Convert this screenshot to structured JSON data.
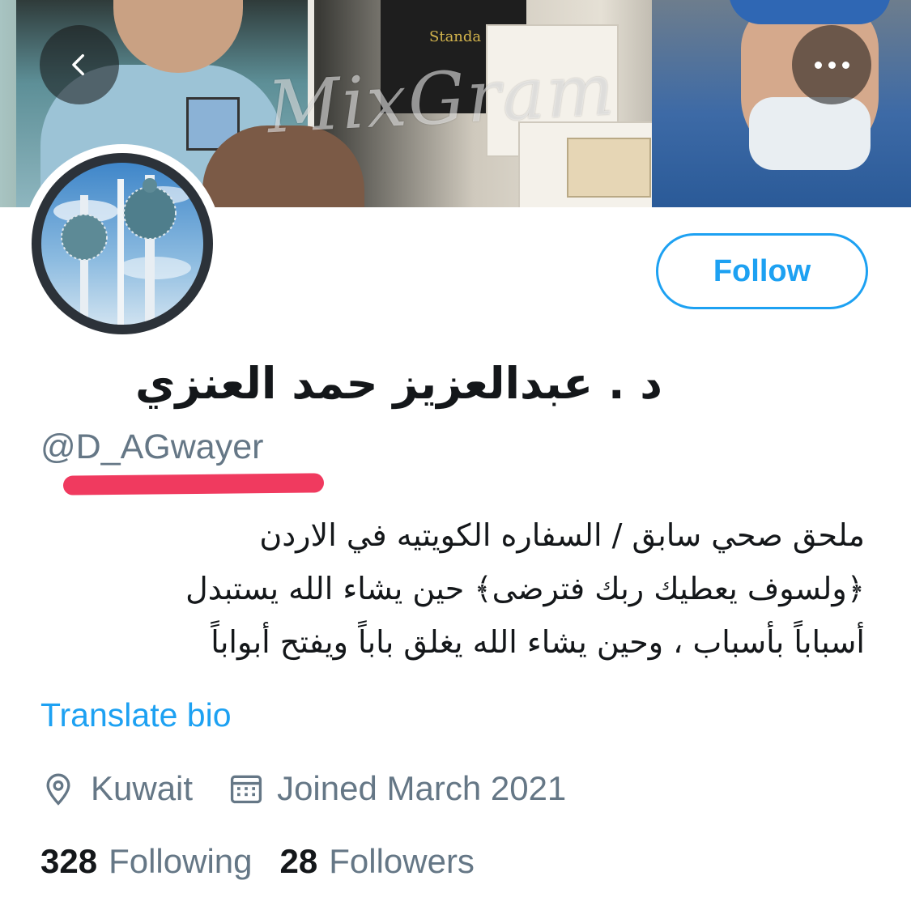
{
  "header": {
    "banner_watermark": "MixGram",
    "back_icon": "chevron-left-icon",
    "more_icon": "more-horizontal-icon"
  },
  "profile": {
    "display_name": "د . عبدالعزيز حمد العنزي",
    "handle": "@D_AGwayer",
    "bio_lines": [
      "ملحق صحي سابق / السفاره الكويتيه في الاردن",
      "﴿ولسوف يعطيك ربك فترضى﴾ حين يشاء الله يستبدل",
      "أسباباً بأسباب ، وحين يشاء الله يغلق باباً ويفتح أبواباً"
    ],
    "translate_label": "Translate bio",
    "location": "Kuwait",
    "location_icon": "location-pin-icon",
    "joined": "Joined March 2021",
    "joined_icon": "calendar-icon",
    "following_count": "328",
    "following_label": "Following",
    "followers_count": "28",
    "followers_label": "Followers"
  },
  "actions": {
    "follow_label": "Follow"
  },
  "colors": {
    "accent": "#1da1f2",
    "secondary_text": "#657786",
    "primary_text": "#14171a",
    "highlight_mark": "#f03a5f"
  }
}
